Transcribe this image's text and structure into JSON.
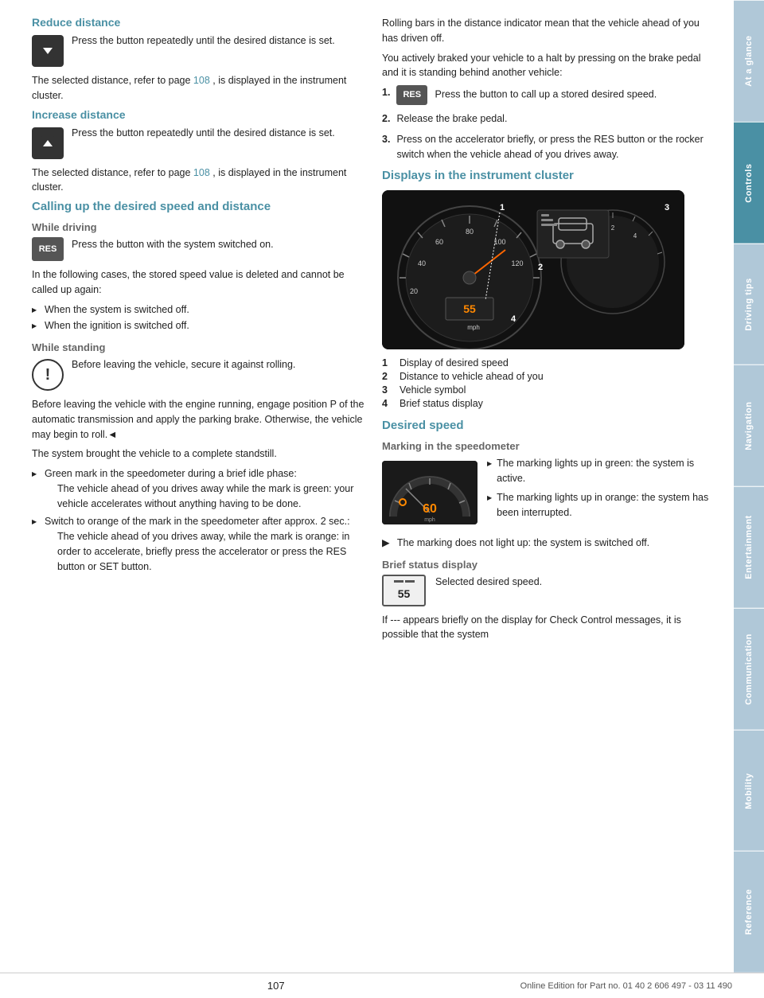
{
  "page": {
    "number": "107",
    "footer_left": "",
    "footer_right": "Online Edition for Part no. 01 40 2 606 497 - 03 11 490"
  },
  "sidebar": {
    "tabs": [
      {
        "id": "at-a-glance",
        "label": "At a glance",
        "active": false
      },
      {
        "id": "controls",
        "label": "Controls",
        "active": true
      },
      {
        "id": "driving-tips",
        "label": "Driving tips",
        "active": false
      },
      {
        "id": "navigation",
        "label": "Navigation",
        "active": false
      },
      {
        "id": "entertainment",
        "label": "Entertainment",
        "active": false
      },
      {
        "id": "communication",
        "label": "Communication",
        "active": false
      },
      {
        "id": "mobility",
        "label": "Mobility",
        "active": false
      },
      {
        "id": "reference",
        "label": "Reference",
        "active": false
      }
    ]
  },
  "left_column": {
    "reduce_distance": {
      "heading": "Reduce distance",
      "icon_desc": "down-arrow-button-icon",
      "button_text": "Press the button repeatedly until the desired distance is set.",
      "body": "The selected distance, refer to page",
      "page_link": "108",
      "body_suffix": ", is displayed in the instrument cluster."
    },
    "increase_distance": {
      "heading": "Increase distance",
      "icon_desc": "up-arrow-button-icon",
      "button_text": "Press the button repeatedly until the desired distance is set.",
      "body": "The selected distance, refer to page",
      "page_link": "108",
      "body_suffix": ", is displayed in the instrument cluster."
    },
    "calling_up": {
      "heading": "Calling up the desired speed and distance",
      "while_driving": {
        "subheading": "While driving",
        "res_label": "RES",
        "button_text": "Press the button with the system switched on.",
        "body": "In the following cases, the stored speed value is deleted and cannot be called up again:",
        "bullets": [
          "When the system is switched off.",
          "When the ignition is switched off."
        ]
      },
      "while_standing": {
        "subheading": "While standing",
        "warning_text": "Before leaving the vehicle, secure it against rolling.",
        "body1": "Before leaving the vehicle with the engine running, engage position P of the automatic transmission and apply the parking brake. Otherwise, the vehicle may begin to roll.◄",
        "body2": "The system brought the vehicle to a complete standstill.",
        "bullets": [
          {
            "main": "Green mark in the speedometer during a brief idle phase:",
            "sub": "The vehicle ahead of you drives away while the mark is green: your vehicle accelerates without anything having to be done."
          },
          {
            "main": "Switch to orange of the mark in the speedometer after approx. 2 sec.:",
            "sub": "The vehicle ahead of you drives away, while the mark is orange: in order to accelerate, briefly press the accelerator or press the RES button or SET button."
          }
        ]
      }
    }
  },
  "right_column": {
    "rolling_bars_text": "Rolling bars in the distance indicator mean that the vehicle ahead of you has driven off.",
    "braked_intro": "You actively braked your vehicle to a halt by pressing on the brake pedal and it is standing behind another vehicle:",
    "numbered_steps": [
      {
        "num": "1.",
        "res_label": "RES",
        "text": "Press the button to call up a stored desired speed."
      },
      {
        "num": "2.",
        "text": "Release the brake pedal."
      },
      {
        "num": "3.",
        "text": "Press on the accelerator briefly, or press the RES button or the rocker switch when the vehicle ahead of you drives away."
      }
    ],
    "displays_section": {
      "heading": "Displays in the instrument cluster",
      "labels": [
        {
          "num": "1",
          "text": "Display of desired speed"
        },
        {
          "num": "2",
          "text": "Distance to vehicle ahead of you"
        },
        {
          "num": "3",
          "text": "Vehicle symbol"
        },
        {
          "num": "4",
          "text": "Brief status display"
        }
      ]
    },
    "desired_speed": {
      "heading": "Desired speed",
      "marking_subheading": "Marking in the speedometer",
      "marking_bullets": [
        "The marking lights up in green: the system is active.",
        "The marking lights up in orange: the system has been interrupted."
      ],
      "no_light_text": "The marking does not light up: the system is switched off.",
      "brief_status": {
        "subheading": "Brief status display",
        "display_num": "55",
        "text": "Selected desired speed."
      },
      "final_text": "If --- appears briefly on the display for Check Control messages, it is possible that the system"
    }
  }
}
